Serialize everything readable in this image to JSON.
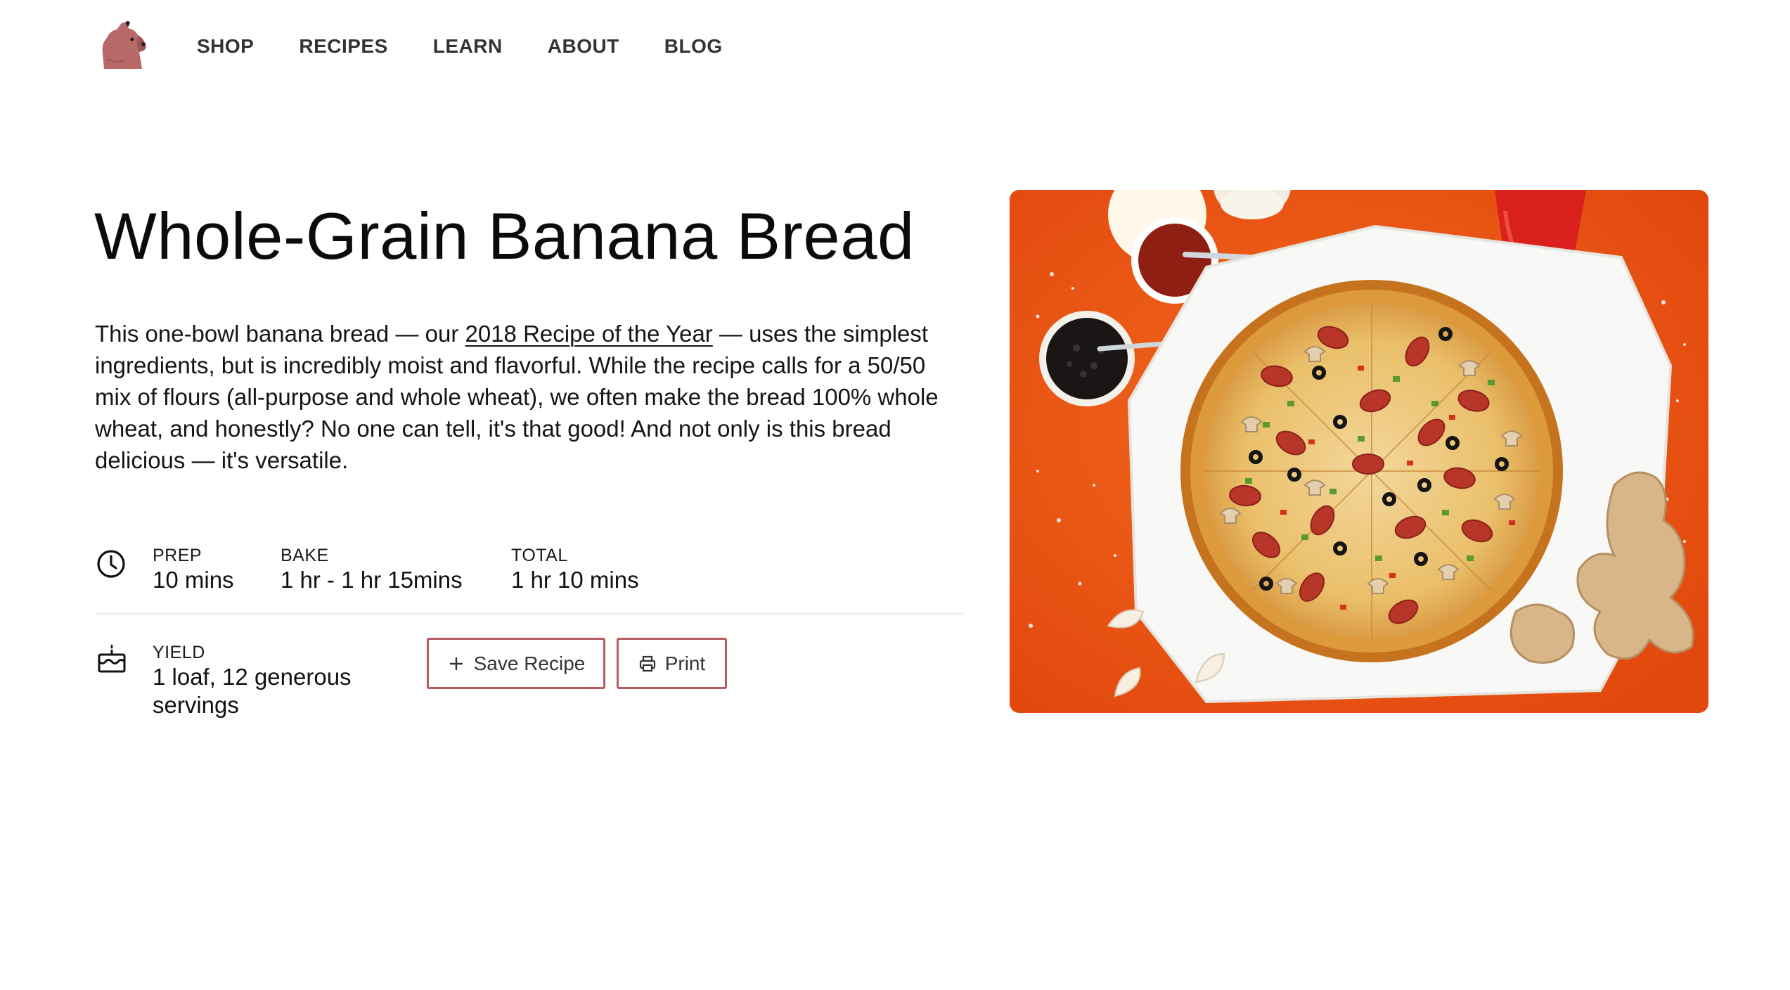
{
  "nav": {
    "logo_name": "bear-logo",
    "items": [
      {
        "label": "SHOP"
      },
      {
        "label": "RECIPES"
      },
      {
        "label": "LEARN"
      },
      {
        "label": "ABOUT"
      },
      {
        "label": "BLOG"
      }
    ]
  },
  "recipe": {
    "title": "Whole-Grain Banana Bread",
    "description_before": "This one-bowl banana bread — our ",
    "description_link": "2018 Recipe of the Year",
    "description_after": " — uses the simplest ingredients, but is incredibly moist and flavorful. While the recipe calls for a 50/50 mix of flours (all-purpose and whole wheat), we often make the bread 100% whole wheat, and honestly? No one can tell, it's that good! And not only is this bread delicious — it's versatile.",
    "times": {
      "icon": "clock-icon",
      "prep_label": "PREP",
      "prep_value": "10 mins",
      "bake_label": "BAKE",
      "bake_value": "1 hr - 1 hr 15mins",
      "total_label": "TOTAL",
      "total_value": "1 hr 10 mins"
    },
    "yield": {
      "icon": "cake-icon",
      "label": "YIELD",
      "value": "1 loaf, 12 generous servings"
    }
  },
  "actions": {
    "save_label": "Save Recipe",
    "save_icon": "plus-icon",
    "print_label": "Print",
    "print_icon": "printer-icon"
  },
  "hero": {
    "image": "pizza-photo"
  },
  "colors": {
    "accent_border": "#b45c62",
    "hero_background": "#f05a16"
  }
}
